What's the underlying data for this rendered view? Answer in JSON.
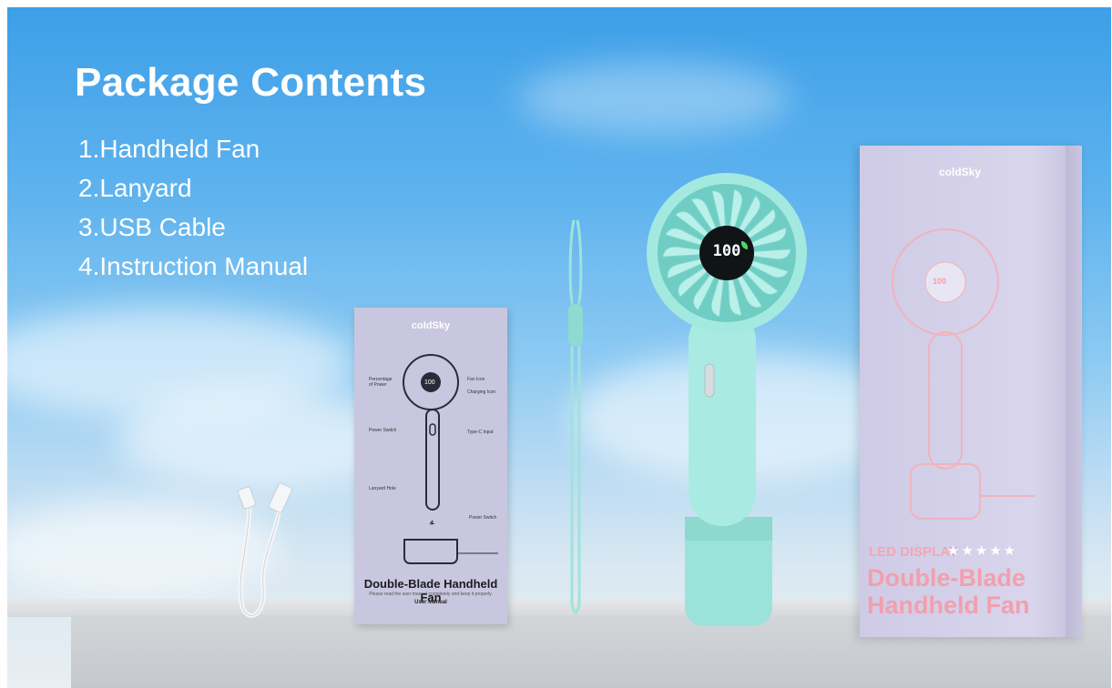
{
  "heading": "Package Contents",
  "items": [
    "1.Handheld Fan",
    "2.Lanyard",
    "3.USB Cable",
    "4.Instruction Manual"
  ],
  "manual": {
    "brand": "coldSky",
    "labels": {
      "percentage": "Percentage of Power",
      "fan_icon": "Fan Icon",
      "charging_icon": "Charging Icon",
      "power_switch": "Power Switch",
      "type_c": "Type-C Input",
      "lanyard_hole": "Lanyard Hole",
      "power_switch_2": "Power Switch"
    },
    "display": "100",
    "title": "Double-Blade Handheld Fan",
    "note": "Please read the user manual completely and keep it properly.",
    "subtitle": "User Manual"
  },
  "fan": {
    "display": "100"
  },
  "box": {
    "brand": "coldSky",
    "display": "100",
    "led": "LED DISPLAY",
    "stars": "★★★★★",
    "line1": "Double-Blade",
    "line2": "Handheld Fan"
  },
  "colors": {
    "sky_top": "#3d9fe8",
    "fan_mint": "#9ee8df",
    "manual_bg": "#c9c7e0",
    "box_bg": "#d8d5ec",
    "box_text": "#f1a0ad"
  }
}
